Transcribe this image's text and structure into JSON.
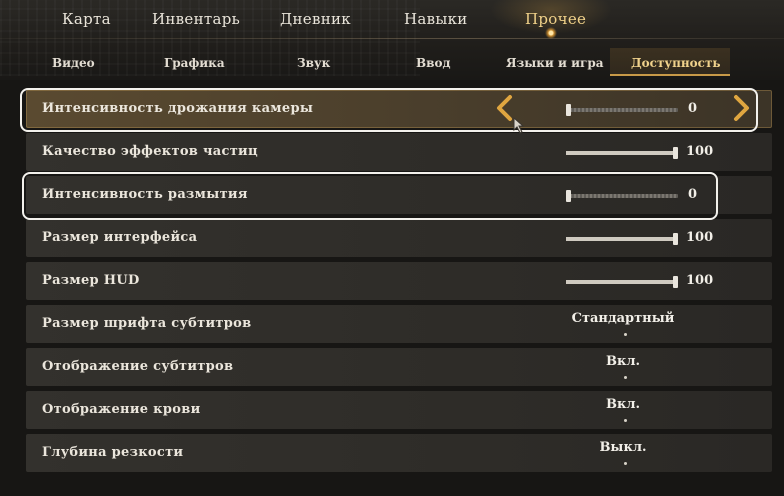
{
  "main_tabs": [
    "Карта",
    "Инвентарь",
    "Дневник",
    "Навыки",
    "Прочее"
  ],
  "active_main_tab": "Прочее",
  "sub_tabs": [
    "Видео",
    "Графика",
    "Звук",
    "Ввод",
    "Языки и игра",
    "Доступность"
  ],
  "active_sub_tab": "Доступность",
  "settings": [
    {
      "label": "Интенсивность дрожания камеры",
      "type": "slider",
      "value": "0",
      "level": 0
    },
    {
      "label": "Качество эффектов частиц",
      "type": "slider",
      "value": "100",
      "level": 1
    },
    {
      "label": "Интенсивность размытия",
      "type": "slider",
      "value": "0",
      "level": 0
    },
    {
      "label": "Размер интерфейса",
      "type": "slider",
      "value": "100",
      "level": 1
    },
    {
      "label": "Размер HUD",
      "type": "slider",
      "value": "100",
      "level": 1
    },
    {
      "label": "Размер шрифта субтитров",
      "type": "choice",
      "value": "Стандартный"
    },
    {
      "label": "Отображение субтитров",
      "type": "choice",
      "value": "Вкл."
    },
    {
      "label": "Отображение крови",
      "type": "choice",
      "value": "Вкл."
    },
    {
      "label": "Глубина резкости",
      "type": "choice",
      "value": "Выкл."
    }
  ],
  "icons": {
    "left_arrow": "chevron-left-icon",
    "right_arrow": "chevron-right-icon",
    "cursor": "mouse-cursor-icon"
  },
  "colors": {
    "accent": "#e0a640",
    "active_tab": "#f1d28a",
    "row_bg": "#33312d",
    "selected_row_bg": "#5a4a30",
    "highlight_outline": "#f3f1ec"
  }
}
